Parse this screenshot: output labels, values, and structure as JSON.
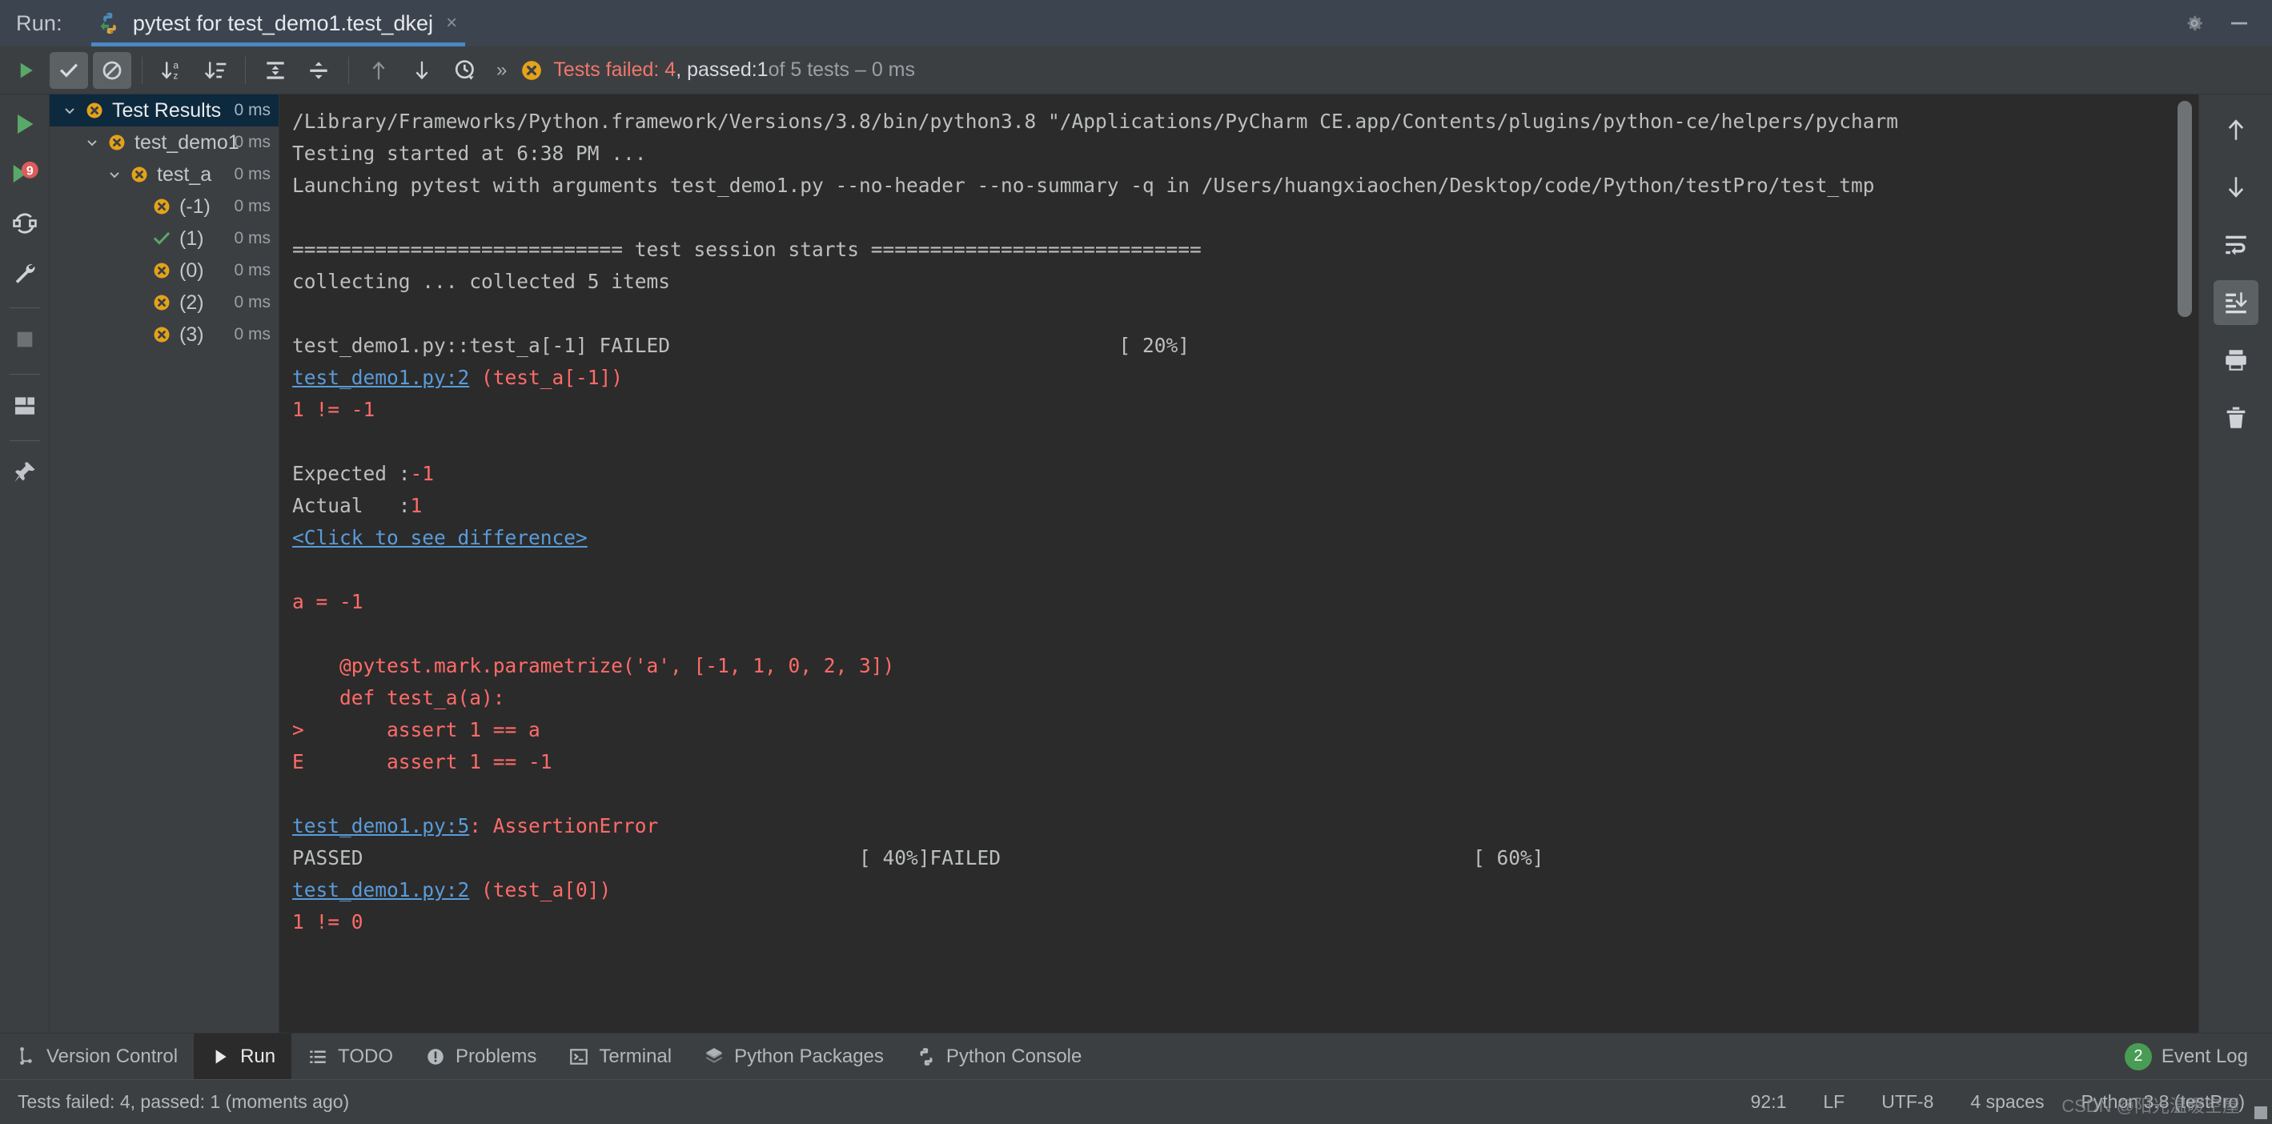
{
  "titlebar": {
    "run_label": "Run:",
    "tab_title": "pytest for test_demo1.test_dkej",
    "tab_close": "×",
    "settings_icon": "gear-icon",
    "minimize_icon": "minimize-icon"
  },
  "toolbar": {
    "rerun_icon": "rerun-play-icon",
    "toggle_passed_icon": "show-passed-checkmark-icon",
    "toggle_ignored_icon": "show-ignored-icon",
    "sort_alpha_icon": "sort-alphabetically-icon",
    "sort_duration_icon": "sort-by-duration-icon",
    "expand_all_icon": "expand-all-icon",
    "collapse_all_icon": "collapse-all-icon",
    "prev_failed_icon": "previous-failed-test-icon",
    "next_failed_icon": "next-failed-test-icon",
    "history_icon": "test-history-clock-icon",
    "overflow_icon": "»",
    "status_icon": "failed-cross-icon",
    "status_failed": "Tests failed: 4",
    "status_passed_prefix": ", passed: ",
    "status_passed_count": "1",
    "status_suffix": " of 5 tests – 0 ms"
  },
  "left_rail": {
    "items": [
      {
        "icon": "run-play-icon",
        "name": "rerun-tests-button"
      },
      {
        "icon": "rerun-failed-tests-icon",
        "name": "rerun-failed-tests-button"
      },
      {
        "icon": "toggle-auto-test-icon",
        "name": "toggle-auto-test-button"
      },
      {
        "icon": "wrench-settings-icon",
        "name": "test-settings-button"
      },
      {
        "icon": "stop-square-icon",
        "name": "stop-button"
      },
      {
        "icon": "layout-panels-icon",
        "name": "layout-settings-button"
      },
      {
        "icon": "pin-icon",
        "name": "pin-tab-button"
      }
    ]
  },
  "tree": {
    "nodes": [
      {
        "label": "Test Results",
        "time": "0 ms",
        "status": "failed",
        "indent": 0,
        "arrow": "expanded",
        "selected": true
      },
      {
        "label": "test_demo1",
        "time": "0 ms",
        "status": "failed",
        "indent": 1,
        "arrow": "expanded",
        "selected": false
      },
      {
        "label": "test_a",
        "time": "0 ms",
        "status": "failed",
        "indent": 2,
        "arrow": "expanded",
        "selected": false
      },
      {
        "label": "(-1)",
        "time": "0 ms",
        "status": "failed",
        "indent": 3,
        "arrow": "none",
        "selected": false
      },
      {
        "label": "(1)",
        "time": "0 ms",
        "status": "passed",
        "indent": 3,
        "arrow": "none",
        "selected": false
      },
      {
        "label": "(0)",
        "time": "0 ms",
        "status": "failed",
        "indent": 3,
        "arrow": "none",
        "selected": false
      },
      {
        "label": "(2)",
        "time": "0 ms",
        "status": "failed",
        "indent": 3,
        "arrow": "none",
        "selected": false
      },
      {
        "label": "(3)",
        "time": "0 ms",
        "status": "failed",
        "indent": 3,
        "arrow": "none",
        "selected": false
      }
    ]
  },
  "console": {
    "lines": [
      {
        "segments": [
          {
            "text": "/Library/Frameworks/Python.framework/Versions/3.8/bin/python3.8 \"/Applications/PyCharm CE.app/Contents/plugins/python-ce/helpers/pycharm",
            "style": "c-white"
          }
        ]
      },
      {
        "segments": [
          {
            "text": "Testing started at 6:38 PM ...",
            "style": "c-white"
          }
        ]
      },
      {
        "segments": [
          {
            "text": "Launching pytest with arguments test_demo1.py --no-header --no-summary -q in /Users/huangxiaochen/Desktop/code/Python/testPro/test_tmp",
            "style": "c-white"
          }
        ]
      },
      {
        "segments": [
          {
            "text": "",
            "style": "c-white"
          }
        ]
      },
      {
        "segments": [
          {
            "text": "============================ test session starts ============================",
            "style": "c-white"
          }
        ]
      },
      {
        "segments": [
          {
            "text": "collecting ... collected 5 items",
            "style": "c-white"
          }
        ]
      },
      {
        "segments": [
          {
            "text": "",
            "style": "c-white"
          }
        ]
      },
      {
        "segments": [
          {
            "text": "test_demo1.py::test_a[-1] FAILED                                      [ 20%]",
            "style": "c-white"
          }
        ]
      },
      {
        "segments": [
          {
            "text": "test_demo1.py:2",
            "style": "c-link"
          },
          {
            "text": " (test_a[-1])",
            "style": "c-red"
          }
        ]
      },
      {
        "segments": [
          {
            "text": "1 != -1",
            "style": "c-red"
          }
        ]
      },
      {
        "segments": [
          {
            "text": "",
            "style": "c-white"
          }
        ]
      },
      {
        "segments": [
          {
            "text": "Expected :",
            "style": "c-white"
          },
          {
            "text": "-1",
            "style": "c-red"
          }
        ]
      },
      {
        "segments": [
          {
            "text": "Actual   :",
            "style": "c-white"
          },
          {
            "text": "1",
            "style": "c-red"
          }
        ]
      },
      {
        "segments": [
          {
            "text": "<Click to see difference>",
            "style": "c-link"
          }
        ]
      },
      {
        "segments": [
          {
            "text": "",
            "style": "c-white"
          }
        ]
      },
      {
        "segments": [
          {
            "text": "a = -1",
            "style": "c-red"
          }
        ]
      },
      {
        "segments": [
          {
            "text": "",
            "style": "c-white"
          }
        ]
      },
      {
        "segments": [
          {
            "text": "    @pytest.mark.parametrize('a', [-1, 1, 0, 2, 3])",
            "style": "c-red"
          }
        ]
      },
      {
        "segments": [
          {
            "text": "    def test_a(a):",
            "style": "c-red"
          }
        ]
      },
      {
        "segments": [
          {
            "text": ">       assert 1 == a",
            "style": "c-red"
          }
        ]
      },
      {
        "segments": [
          {
            "text": "E       assert 1 == -1",
            "style": "c-red"
          }
        ]
      },
      {
        "segments": [
          {
            "text": "",
            "style": "c-white"
          }
        ]
      },
      {
        "segments": [
          {
            "text": "test_demo1.py:5",
            "style": "c-link"
          },
          {
            "text": ": AssertionError",
            "style": "c-red"
          }
        ]
      },
      {
        "segments": [
          {
            "text": "PASSED                                          [ 40%]FAILED                                        [ 60%]",
            "style": "c-white"
          }
        ]
      },
      {
        "segments": [
          {
            "text": "test_demo1.py:2",
            "style": "c-link"
          },
          {
            "text": " (test_a[0])",
            "style": "c-red"
          }
        ]
      },
      {
        "segments": [
          {
            "text": "1 != 0",
            "style": "c-red"
          }
        ]
      }
    ]
  },
  "right_rail": {
    "items": [
      {
        "icon": "scroll-up-icon",
        "name": "up-the-stack-trace-button",
        "active": false
      },
      {
        "icon": "scroll-down-icon",
        "name": "down-the-stack-trace-button",
        "active": false
      },
      {
        "icon": "soft-wrap-icon",
        "name": "soft-wrap-button",
        "active": false
      },
      {
        "icon": "scroll-to-end-icon",
        "name": "scroll-to-end-button",
        "active": true
      },
      {
        "icon": "printer-icon",
        "name": "print-button",
        "active": false
      },
      {
        "icon": "trash-icon",
        "name": "clear-all-button",
        "active": false
      }
    ]
  },
  "toolwindow_bar": {
    "buttons": [
      {
        "label": "Version Control",
        "icon": "version-control-icon",
        "active": false
      },
      {
        "label": "Run",
        "icon": "run-play-icon",
        "active": true
      },
      {
        "label": "TODO",
        "icon": "todo-list-icon",
        "active": false
      },
      {
        "label": "Problems",
        "icon": "problems-icon",
        "active": false
      },
      {
        "label": "Terminal",
        "icon": "terminal-icon",
        "active": false
      },
      {
        "label": "Python Packages",
        "icon": "packages-icon",
        "active": false
      },
      {
        "label": "Python Console",
        "icon": "python-console-icon",
        "active": false
      }
    ],
    "event_log_count": "2",
    "event_log_label": "Event Log"
  },
  "statusbar": {
    "message": "Tests failed: 4, passed: 1 (moments ago)",
    "caret": "92:1",
    "line_separator": "LF",
    "encoding": "UTF-8",
    "indent": "4 spaces",
    "interpreter": "Python 3.8 (testPro)",
    "watermark": "CSDN @阳光温暖空屋"
  }
}
